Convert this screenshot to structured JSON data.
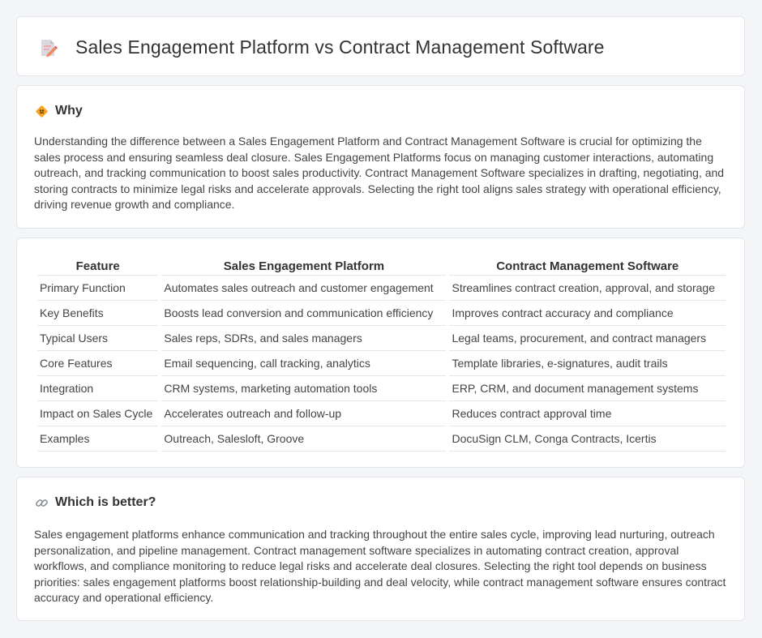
{
  "page": {
    "title": "Sales Engagement Platform vs Contract Management Software",
    "icon": "document-pencil-icon"
  },
  "why": {
    "icon": "diamond-sign-icon",
    "title": "Why",
    "body": "Understanding the difference between a Sales Engagement Platform and Contract Management Software is crucial for optimizing the sales process and ensuring seamless deal closure. Sales Engagement Platforms focus on managing customer interactions, automating outreach, and tracking communication to boost sales productivity. Contract Management Software specializes in drafting, negotiating, and storing contracts to minimize legal risks and accelerate approvals. Selecting the right tool aligns sales strategy with operational efficiency, driving revenue growth and compliance."
  },
  "table": {
    "headers": [
      "Feature",
      "Sales Engagement Platform",
      "Contract Management Software"
    ],
    "rows": [
      [
        "Primary Function",
        "Automates sales outreach and customer engagement",
        "Streamlines contract creation, approval, and storage"
      ],
      [
        "Key Benefits",
        "Boosts lead conversion and communication efficiency",
        "Improves contract accuracy and compliance"
      ],
      [
        "Typical Users",
        "Sales reps, SDRs, and sales managers",
        "Legal teams, procurement, and contract managers"
      ],
      [
        "Core Features",
        "Email sequencing, call tracking, analytics",
        "Template libraries, e-signatures, audit trails"
      ],
      [
        "Integration",
        "CRM systems, marketing automation tools",
        "ERP, CRM, and document management systems"
      ],
      [
        "Impact on Sales Cycle",
        "Accelerates outreach and follow-up",
        "Reduces contract approval time"
      ],
      [
        "Examples",
        "Outreach, Salesloft, Groove",
        "DocuSign CLM, Conga Contracts, Icertis"
      ]
    ]
  },
  "better": {
    "icon": "link-icon",
    "title": "Which is better?",
    "body": "Sales engagement platforms enhance communication and tracking throughout the entire sales cycle, improving lead nurturing, outreach personalization, and pipeline management. Contract management software specializes in automating contract creation, approval workflows, and compliance monitoring to reduce legal risks and accelerate deal closures. Selecting the right tool depends on business priorities: sales engagement platforms boost relationship-building and deal velocity, while contract management software ensures contract accuracy and operational efficiency."
  },
  "colors": {
    "background": "#f4f5f7",
    "card": "#ffffff",
    "border": "#e2e5ea",
    "text": "#444444",
    "icon_accent": "#f5a25d"
  }
}
